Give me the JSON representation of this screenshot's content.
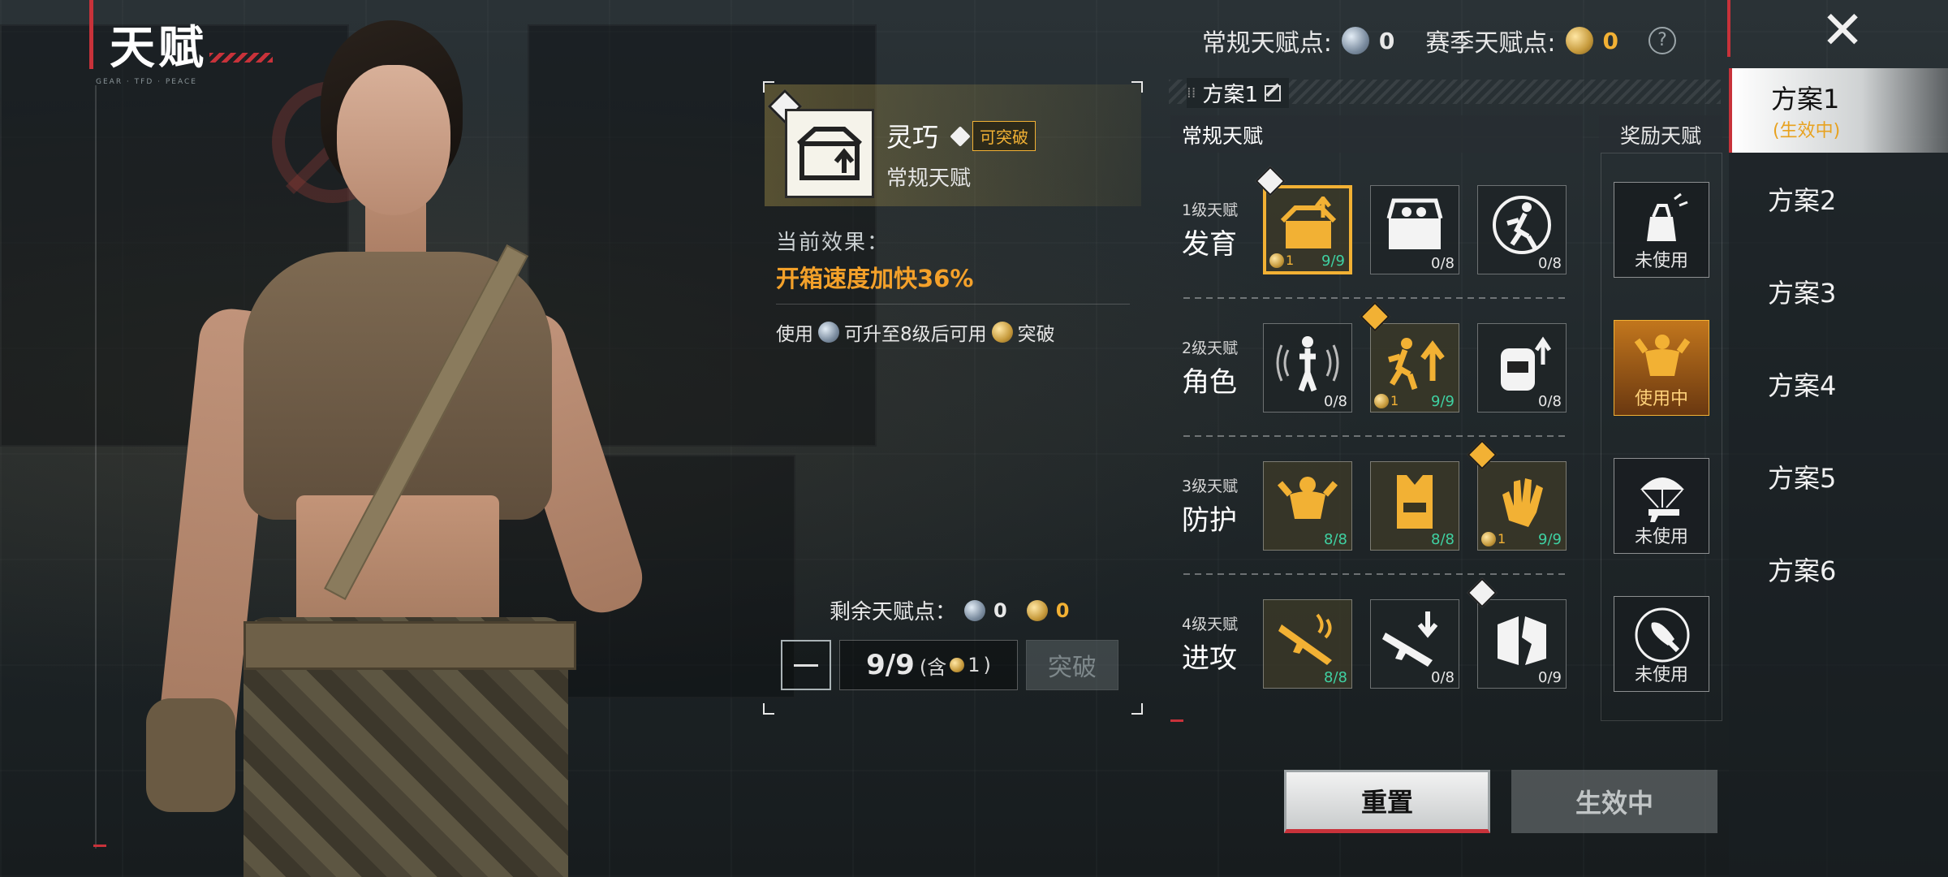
{
  "header": {
    "title": "天赋",
    "subtitle": "GEAR · TFD · PEACE"
  },
  "top_bar": {
    "normal_points_label": "常规天赋点:",
    "normal_points_value": "0",
    "season_points_label": "赛季天赋点:",
    "season_points_value": "0",
    "help": "?",
    "close": "✕"
  },
  "plans": [
    {
      "label": "方案1",
      "sub": "(生效中)",
      "active": true
    },
    {
      "label": "方案2",
      "sub": "",
      "active": false
    },
    {
      "label": "方案3",
      "sub": "",
      "active": false
    },
    {
      "label": "方案4",
      "sub": "",
      "active": false
    },
    {
      "label": "方案5",
      "sub": "",
      "active": false
    },
    {
      "label": "方案6",
      "sub": "",
      "active": false
    }
  ],
  "detail": {
    "name": "灵巧",
    "breakable_tag": "可突破",
    "type": "常规天赋",
    "effect_label": "当前效果：",
    "effect_value": "开箱速度加快36%",
    "note_prefix": "使用",
    "note_middle": "可升至8级后可用",
    "note_suffix": "突破",
    "remaining_label": "剩余天赋点：",
    "remaining_normal": "0",
    "remaining_season": "0",
    "level": "9/9",
    "level_incl_prefix": "(含",
    "level_incl_value": "1",
    "level_incl_suffix": ")",
    "break_button": "突破"
  },
  "scheme": {
    "name": "方案1"
  },
  "grid": {
    "normal_header": "常规天赋",
    "bonus_header": "奖励天赋",
    "tiers": [
      {
        "small": "1级天赋",
        "name": "发育",
        "talents": [
          {
            "icon": "open-box-icon",
            "level": "9/9",
            "coin": "1",
            "selected": true,
            "badge": "white"
          },
          {
            "icon": "supply-chest-icon",
            "level": "0/8"
          },
          {
            "icon": "runner-icon",
            "level": "0/8"
          }
        ],
        "bonus": {
          "icon": "hand-drop-icon",
          "state": "未使用"
        }
      },
      {
        "small": "2级天赋",
        "name": "角色",
        "talents": [
          {
            "icon": "sound-soldier-icon",
            "level": "0/8"
          },
          {
            "icon": "sprint-up-icon",
            "level": "9/9",
            "coin": "1",
            "badge": "gold"
          },
          {
            "icon": "backpack-up-icon",
            "level": "0/8"
          }
        ],
        "bonus": {
          "icon": "strongman-icon",
          "state": "使用中"
        }
      },
      {
        "small": "3级天赋",
        "name": "防护",
        "talents": [
          {
            "icon": "muscle-up-icon",
            "level": "8/8"
          },
          {
            "icon": "vest-up-icon",
            "level": "8/8"
          },
          {
            "icon": "glove-icon",
            "level": "9/9",
            "coin": "1",
            "badge": "gold"
          }
        ],
        "bonus": {
          "icon": "parachute-gun-icon",
          "state": "未使用"
        }
      },
      {
        "small": "4级天赋",
        "name": "进攻",
        "talents": [
          {
            "icon": "rifle-fire-icon",
            "level": "8/8"
          },
          {
            "icon": "rifle-down-icon",
            "level": "0/8"
          },
          {
            "icon": "broken-wall-icon",
            "level": "0/9",
            "badge": "white"
          }
        ],
        "bonus": {
          "icon": "bullet-icon",
          "state": "未使用"
        }
      }
    ]
  },
  "buttons": {
    "reset": "重置",
    "active": "生效中"
  },
  "colors": {
    "accent_red": "#c8323a",
    "gold": "#f2b134",
    "orange": "#f4a12a",
    "max_green": "#3fd1a2"
  }
}
